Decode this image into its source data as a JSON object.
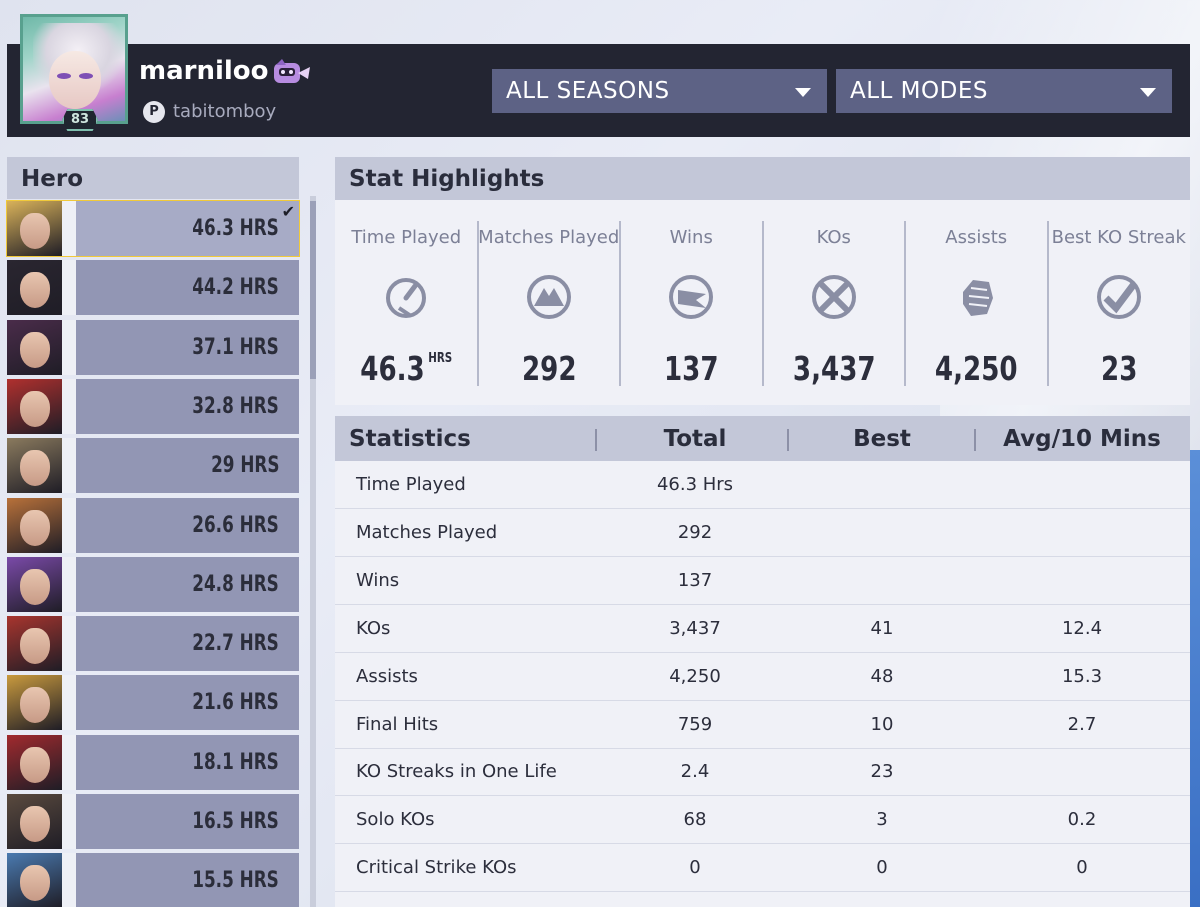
{
  "player": {
    "name": "marniloo",
    "tag": "tabitomboy",
    "level": "83",
    "platform_icon": "playstation-icon"
  },
  "filters": {
    "season": "ALL SEASONS",
    "mode": "ALL MODES"
  },
  "hero_panel": {
    "title": "Hero",
    "heroes": [
      {
        "hours": "46.3 HRS",
        "selected": true
      },
      {
        "hours": "44.2 HRS"
      },
      {
        "hours": "37.1 HRS"
      },
      {
        "hours": "32.8 HRS"
      },
      {
        "hours": "29 HRS"
      },
      {
        "hours": "26.6 HRS"
      },
      {
        "hours": "24.8 HRS"
      },
      {
        "hours": "22.7 HRS"
      },
      {
        "hours": "21.6 HRS"
      },
      {
        "hours": "18.1 HRS"
      },
      {
        "hours": "16.5 HRS"
      },
      {
        "hours": "15.5 HRS"
      }
    ],
    "portrait_colors": [
      "#d9b25a",
      "#2a2630",
      "#4a2c4a",
      "#b0302e",
      "#8a7a5e",
      "#b8713a",
      "#7a4aa8",
      "#a8352e",
      "#c99a3e",
      "#a12a2e",
      "#5a4a3e",
      "#4a7ab0"
    ]
  },
  "highlights": {
    "title": "Stat Highlights",
    "items": [
      {
        "label": "Time Played",
        "value": "46.3",
        "unit": "HRS",
        "icon": "stopwatch-icon"
      },
      {
        "label": "Matches Played",
        "value": "292",
        "icon": "mountain-emblem-icon"
      },
      {
        "label": "Wins",
        "value": "137",
        "icon": "flag-icon"
      },
      {
        "label": "KOs",
        "value": "3,437",
        "icon": "crossed-swords-icon"
      },
      {
        "label": "Assists",
        "value": "4,250",
        "icon": "fist-icon"
      },
      {
        "label": "Best KO Streak",
        "value": "23",
        "icon": "streak-check-icon"
      }
    ]
  },
  "statistics": {
    "headers": {
      "name": "Statistics",
      "total": "Total",
      "best": "Best",
      "avg": "Avg/10 Mins"
    },
    "rows": [
      {
        "name": "Time Played",
        "total": "46.3 Hrs",
        "best": "",
        "avg": ""
      },
      {
        "name": "Matches Played",
        "total": "292",
        "best": "",
        "avg": ""
      },
      {
        "name": "Wins",
        "total": "137",
        "best": "",
        "avg": ""
      },
      {
        "name": "KOs",
        "total": "3,437",
        "best": "41",
        "avg": "12.4"
      },
      {
        "name": "Assists",
        "total": "4,250",
        "best": "48",
        "avg": "15.3"
      },
      {
        "name": "Final Hits",
        "total": "759",
        "best": "10",
        "avg": "2.7"
      },
      {
        "name": "KO Streaks in One Life",
        "total": "2.4",
        "best": "23",
        "avg": ""
      },
      {
        "name": "Solo KOs",
        "total": "68",
        "best": "3",
        "avg": "0.2"
      },
      {
        "name": "Critical Strike KOs",
        "total": "0",
        "best": "0",
        "avg": "0"
      }
    ]
  },
  "colors": {
    "accent_selected": "#f0c93a",
    "header_bg": "#232532",
    "dropdown_bg": "#5d6285",
    "hero_bar": "#9296b4"
  }
}
